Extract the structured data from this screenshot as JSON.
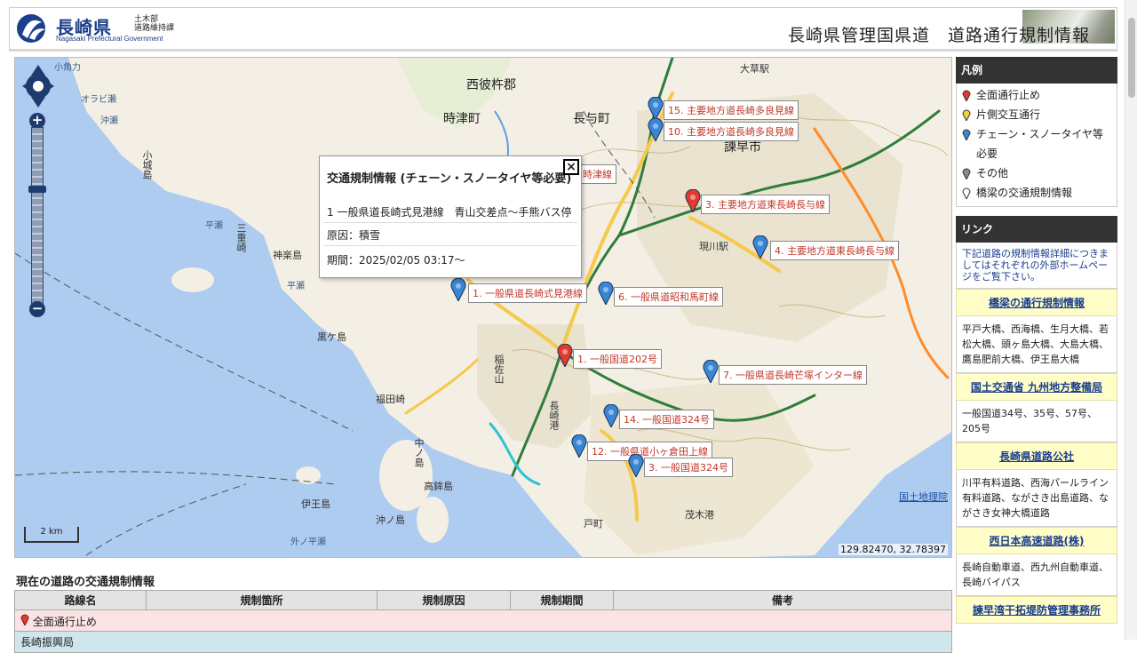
{
  "header": {
    "logo_pref": "長崎県",
    "logo_dept_1": "土木部",
    "logo_dept_2": "道路維持課",
    "logo_eng": "Nagasaki Prefectural Government",
    "title": "長崎県管理国県道　道路通行規制情報"
  },
  "map": {
    "places": [
      {
        "label": "西彼杵郡",
        "cls": "big"
      },
      {
        "label": "時津町",
        "cls": "big"
      },
      {
        "label": "長与町",
        "cls": "big"
      },
      {
        "label": "諫早市",
        "cls": "big"
      },
      {
        "label": "小角力",
        "cls": "sea"
      },
      {
        "label": "オラビ瀬",
        "cls": "sea"
      },
      {
        "label": "沖瀬",
        "cls": "sea"
      },
      {
        "label": "小城島",
        "cls": ""
      },
      {
        "label": "平瀬",
        "cls": "sea"
      },
      {
        "label": "三重崎",
        "cls": ""
      },
      {
        "label": "神楽島",
        "cls": ""
      },
      {
        "label": "平瀬",
        "cls": "sea"
      },
      {
        "label": "黒ケ島",
        "cls": ""
      },
      {
        "label": "福田崎",
        "cls": ""
      },
      {
        "label": "稲佐山",
        "cls": ""
      },
      {
        "label": "長崎港",
        "cls": ""
      },
      {
        "label": "中ノ島",
        "cls": ""
      },
      {
        "label": "高鉾島",
        "cls": ""
      },
      {
        "label": "伊王島",
        "cls": ""
      },
      {
        "label": "沖ノ島",
        "cls": ""
      },
      {
        "label": "外ノ平瀬",
        "cls": "sea"
      },
      {
        "label": "戸町",
        "cls": ""
      },
      {
        "label": "茂木港",
        "cls": ""
      },
      {
        "label": "現川駅",
        "cls": ""
      },
      {
        "label": "大草駅",
        "cls": ""
      }
    ],
    "markers": [
      {
        "label": "15. 主要地方道長崎多良見線",
        "color": "blue"
      },
      {
        "label": "10. 主要地方道長崎多良見線",
        "color": "blue"
      },
      {
        "label": "3. 主要地方道東長崎長与線",
        "color": "red"
      },
      {
        "label": "4. 主要地方道東長崎長与線",
        "color": "blue"
      },
      {
        "label": "1. 一般県道長崎式見港線",
        "color": "blue"
      },
      {
        "label": "6. 一般県道昭和馬町線",
        "color": "blue"
      },
      {
        "label": "1. 一般国道202号",
        "color": "red"
      },
      {
        "label": "7. 一般県道長崎芒塚インター線",
        "color": "blue"
      },
      {
        "label": "14. 一般国道324号",
        "color": "blue"
      },
      {
        "label": "12. 一般県道小ヶ倉田上線",
        "color": "blue"
      },
      {
        "label": "3. 一般国道324号",
        "color": "blue"
      },
      {
        "label": "時津線",
        "color": "blue"
      }
    ],
    "popup": {
      "title": "交通規制情報 (チェーン・スノータイヤ等必要)",
      "route": "1 一般県道長崎式見港線　青山交差点～手熊バス停",
      "cause": "原因：積雪",
      "period": "期間：2025/02/05 03:17～",
      "close": "×"
    },
    "scale": "2 km",
    "coords": "129.82470, 32.78397",
    "attribution": "国土地理院",
    "colors": {
      "restriction_red": "#e23b2e",
      "chain_blue": "#3a86d6",
      "sea": "#aecbf0",
      "land": "#f3efe4"
    }
  },
  "sidebar": {
    "legend_title": "凡例",
    "legend": [
      {
        "label": "全面通行止め",
        "color": "#e23b2e"
      },
      {
        "label": "片側交互通行",
        "color": "#f2d24a"
      },
      {
        "label": "チェーン・スノータイヤ等必要",
        "color": "#3a86d6"
      },
      {
        "label": "その他",
        "color": "#8a8a8a"
      },
      {
        "label": "橋梁の交通規制情報",
        "color": "#ffffff"
      }
    ],
    "links_title": "リンク",
    "links_intro": "下記道路の規制情報詳細につきましてはそれぞれの外部ホームページをご覧下さい。",
    "links": [
      {
        "title": "橋梁の通行規制情報",
        "body": "平戸大橋、西海橋、生月大橋、若松大橋、頭ヶ島大橋、大島大橋、鷹島肥前大橋、伊王島大橋"
      },
      {
        "title": "国土交通省 九州地方整備局",
        "body": "一般国道34号、35号、57号、205号"
      },
      {
        "title": "長崎県道路公社",
        "body": "川平有料道路、西海パールライン有料道路、ながさき出島道路、ながさき女神大橋道路"
      },
      {
        "title": "西日本高速道路(株)",
        "body": "長崎自動車道、西九州自動車道、長崎バイパス"
      },
      {
        "title": "諫早湾干拓堤防管理事務所",
        "body": ""
      }
    ]
  },
  "table": {
    "title": "現在の道路の交通規制情報",
    "headers": [
      "路線名",
      "規制箇所",
      "規制原因",
      "規制期間",
      "備考"
    ],
    "group_red": "全面通行止め",
    "group_blue": "長崎振興局"
  }
}
